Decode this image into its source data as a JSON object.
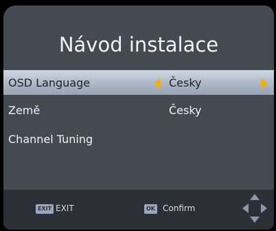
{
  "title": "Návod instalace",
  "menu": [
    {
      "label": "OSD Language",
      "value": "Česky",
      "selected": true
    },
    {
      "label": "Země",
      "value": "Česky",
      "selected": false
    },
    {
      "label": "Channel Tuning",
      "value": "",
      "selected": false
    }
  ],
  "footer": {
    "exit_key": "EXIT",
    "exit_label": "EXIT",
    "ok_key": "OK",
    "confirm_label": "Confirm"
  },
  "colors": {
    "background": "#454a52",
    "highlight": "#aab4c4",
    "arrow": "#f5b000",
    "footer": "#2c3036"
  },
  "icons": [
    "arrow-left-icon",
    "arrow-right-icon",
    "exit-key-icon",
    "ok-key-icon",
    "navigation-arrows-icon"
  ]
}
